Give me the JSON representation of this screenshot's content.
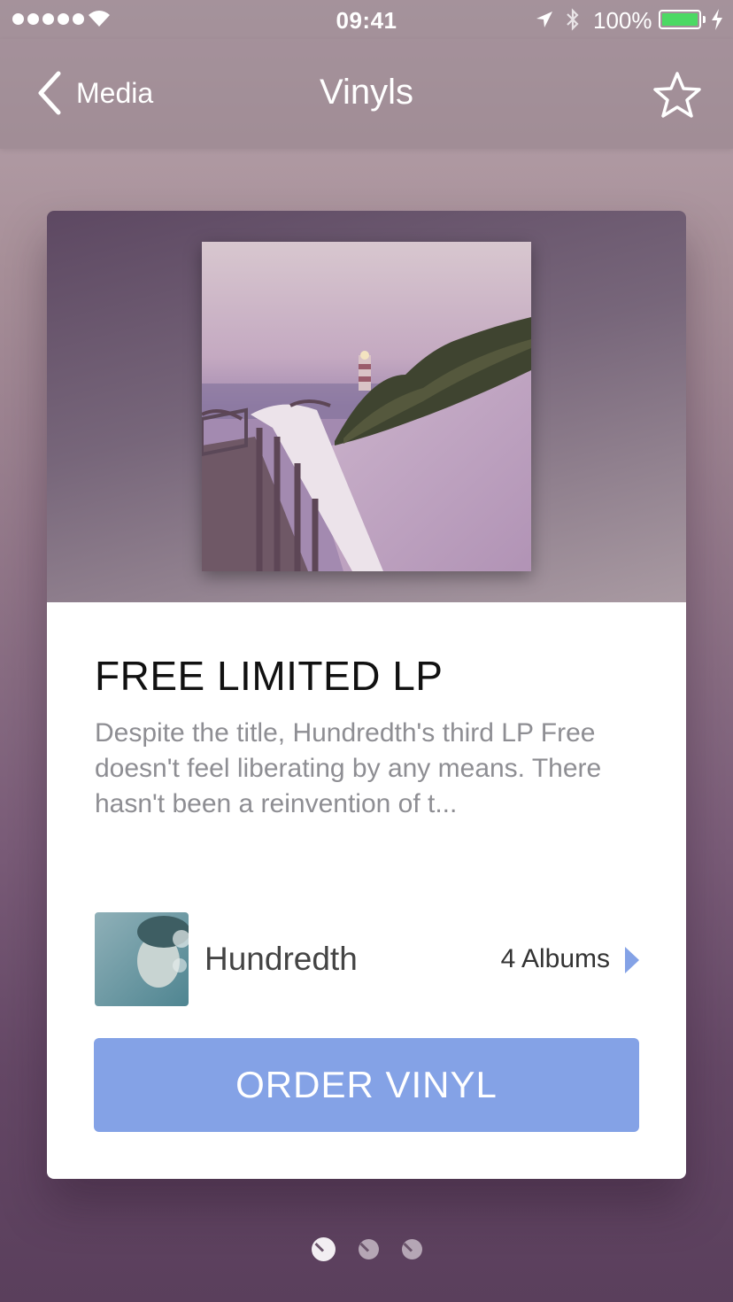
{
  "status_bar": {
    "time": "09:41",
    "battery_percent": "100%",
    "battery_level": 1.0,
    "battery_color": "#4cd964"
  },
  "nav": {
    "back_label": "Media",
    "title": "Vinyls",
    "star_icon": "star-outline-icon"
  },
  "card": {
    "title": "FREE LIMITED LP",
    "description": "Despite the title, Hundredth's third LP Free doesn't feel liberating by any means. There hasn't been a reinvention of t...",
    "artist": {
      "name": "Hundredth",
      "albums_label": "4 Albums"
    },
    "order_button": "ORDER VINYL",
    "accent_color": "#84a2e6"
  },
  "pager": {
    "count": 3,
    "active_index": 0
  }
}
